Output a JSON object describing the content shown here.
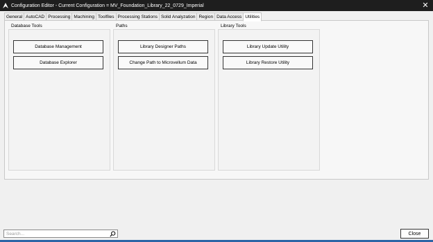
{
  "window": {
    "title": "Configuration Editor - Current Configuration = MV_Foundation_Library_22_0729_Imperial",
    "close_glyph": "✕"
  },
  "tabs": [
    {
      "label": "General",
      "active": false
    },
    {
      "label": "AutoCAD",
      "active": false
    },
    {
      "label": "Processing",
      "active": false
    },
    {
      "label": "Machining",
      "active": false
    },
    {
      "label": "Toolfiles",
      "active": false
    },
    {
      "label": "Processing Stations",
      "active": false
    },
    {
      "label": "Solid Analyzation",
      "active": false
    },
    {
      "label": "Region",
      "active": false
    },
    {
      "label": "Data Access",
      "active": false
    },
    {
      "label": "Utilities",
      "active": true
    }
  ],
  "groups": {
    "database_tools": {
      "title": "Database Tools",
      "buttons": [
        "Database Management",
        "Database Explorer"
      ]
    },
    "paths": {
      "title": "Paths",
      "buttons": [
        "Library Designer Paths",
        "Change Path to Microvellum Data"
      ]
    },
    "library_tools": {
      "title": "Library Tools",
      "buttons": [
        "Library Update Utility",
        "Library Restore Utility"
      ]
    }
  },
  "footer": {
    "search_placeholder": "Search...",
    "search_value": "",
    "close_label": "Close"
  },
  "icons": {
    "app": "app-logo-icon",
    "search": "search-icon",
    "close": "close-icon"
  },
  "colors": {
    "titlebar": "#1e1e1e",
    "accent_strip": "#2b64a6"
  }
}
